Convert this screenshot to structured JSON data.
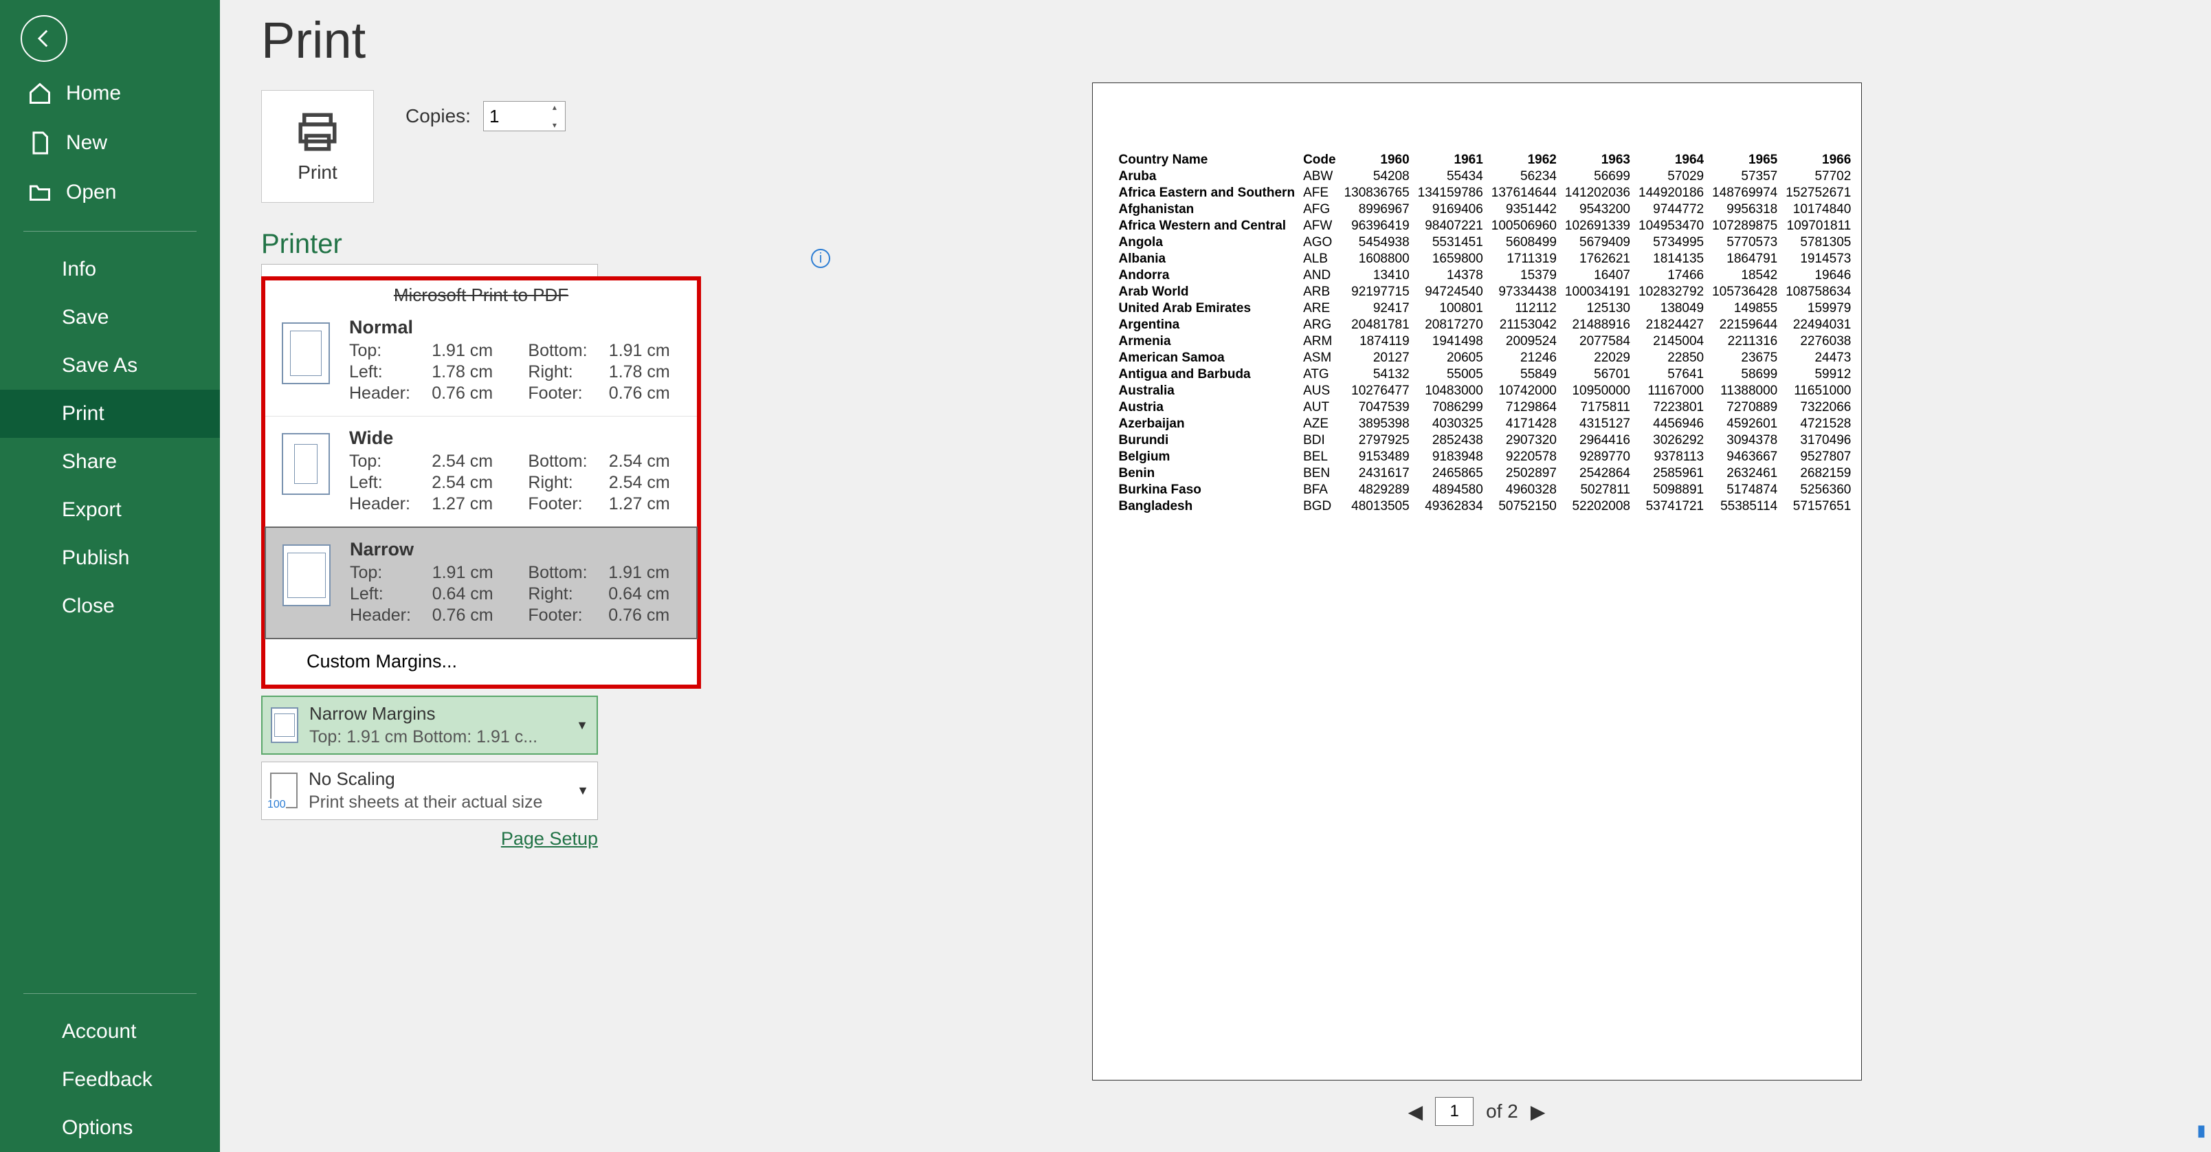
{
  "sidebar": {
    "home": "Home",
    "new": "New",
    "open": "Open",
    "info": "Info",
    "save": "Save",
    "saveas": "Save As",
    "print": "Print",
    "share": "Share",
    "export": "Export",
    "publish": "Publish",
    "close": "Close",
    "account": "Account",
    "feedback": "Feedback",
    "options": "Options"
  },
  "page": {
    "title": "Print",
    "print_label": "Print",
    "copies_label": "Copies:",
    "copies_value": "1",
    "printer_heading": "Printer",
    "hidden_printer": "Microsoft Print to PDF"
  },
  "margins": {
    "custom": "Custom Margins...",
    "options": [
      {
        "name": "Normal",
        "top_l": "Top:",
        "top_v": "1.91 cm",
        "bot_l": "Bottom:",
        "bot_v": "1.91 cm",
        "left_l": "Left:",
        "left_v": "1.78 cm",
        "right_l": "Right:",
        "right_v": "1.78 cm",
        "hdr_l": "Header:",
        "hdr_v": "0.76 cm",
        "ftr_l": "Footer:",
        "ftr_v": "0.76 cm"
      },
      {
        "name": "Wide",
        "top_l": "Top:",
        "top_v": "2.54 cm",
        "bot_l": "Bottom:",
        "bot_v": "2.54 cm",
        "left_l": "Left:",
        "left_v": "2.54 cm",
        "right_l": "Right:",
        "right_v": "2.54 cm",
        "hdr_l": "Header:",
        "hdr_v": "1.27 cm",
        "ftr_l": "Footer:",
        "ftr_v": "1.27 cm"
      },
      {
        "name": "Narrow",
        "top_l": "Top:",
        "top_v": "1.91 cm",
        "bot_l": "Bottom:",
        "bot_v": "1.91 cm",
        "left_l": "Left:",
        "left_v": "0.64 cm",
        "right_l": "Right:",
        "right_v": "0.64 cm",
        "hdr_l": "Header:",
        "hdr_v": "0.76 cm",
        "ftr_l": "Footer:",
        "ftr_v": "0.76 cm"
      }
    ]
  },
  "settings_rows": {
    "margins_title": "Narrow Margins",
    "margins_sub": "Top: 1.91 cm Bottom: 1.91 c...",
    "scaling_title": "No Scaling",
    "scaling_sub": "Print sheets at their actual size"
  },
  "page_setup": "Page Setup",
  "pager": {
    "current": "1",
    "of": "of 2"
  },
  "preview": {
    "headers": [
      "Country Name",
      "Code",
      "1960",
      "1961",
      "1962",
      "1963",
      "1964",
      "1965",
      "1966"
    ],
    "rows": [
      [
        "Aruba",
        "ABW",
        "54208",
        "55434",
        "56234",
        "56699",
        "57029",
        "57357",
        "57702"
      ],
      [
        "Africa Eastern and Southern",
        "AFE",
        "130836765",
        "134159786",
        "137614644",
        "141202036",
        "144920186",
        "148769974",
        "152752671"
      ],
      [
        "Afghanistan",
        "AFG",
        "8996967",
        "9169406",
        "9351442",
        "9543200",
        "9744772",
        "9956318",
        "10174840"
      ],
      [
        "Africa Western and Central",
        "AFW",
        "96396419",
        "98407221",
        "100506960",
        "102691339",
        "104953470",
        "107289875",
        "109701811"
      ],
      [
        "Angola",
        "AGO",
        "5454938",
        "5531451",
        "5608499",
        "5679409",
        "5734995",
        "5770573",
        "5781305"
      ],
      [
        "Albania",
        "ALB",
        "1608800",
        "1659800",
        "1711319",
        "1762621",
        "1814135",
        "1864791",
        "1914573"
      ],
      [
        "Andorra",
        "AND",
        "13410",
        "14378",
        "15379",
        "16407",
        "17466",
        "18542",
        "19646"
      ],
      [
        "Arab World",
        "ARB",
        "92197715",
        "94724540",
        "97334438",
        "100034191",
        "102832792",
        "105736428",
        "108758634"
      ],
      [
        "United Arab Emirates",
        "ARE",
        "92417",
        "100801",
        "112112",
        "125130",
        "138049",
        "149855",
        "159979"
      ],
      [
        "Argentina",
        "ARG",
        "20481781",
        "20817270",
        "21153042",
        "21488916",
        "21824427",
        "22159644",
        "22494031"
      ],
      [
        "Armenia",
        "ARM",
        "1874119",
        "1941498",
        "2009524",
        "2077584",
        "2145004",
        "2211316",
        "2276038"
      ],
      [
        "American Samoa",
        "ASM",
        "20127",
        "20605",
        "21246",
        "22029",
        "22850",
        "23675",
        "24473"
      ],
      [
        "Antigua and Barbuda",
        "ATG",
        "54132",
        "55005",
        "55849",
        "56701",
        "57641",
        "58699",
        "59912"
      ],
      [
        "Australia",
        "AUS",
        "10276477",
        "10483000",
        "10742000",
        "10950000",
        "11167000",
        "11388000",
        "11651000"
      ],
      [
        "Austria",
        "AUT",
        "7047539",
        "7086299",
        "7129864",
        "7175811",
        "7223801",
        "7270889",
        "7322066"
      ],
      [
        "Azerbaijan",
        "AZE",
        "3895398",
        "4030325",
        "4171428",
        "4315127",
        "4456946",
        "4592601",
        "4721528"
      ],
      [
        "Burundi",
        "BDI",
        "2797925",
        "2852438",
        "2907320",
        "2964416",
        "3026292",
        "3094378",
        "3170496"
      ],
      [
        "Belgium",
        "BEL",
        "9153489",
        "9183948",
        "9220578",
        "9289770",
        "9378113",
        "9463667",
        "9527807"
      ],
      [
        "Benin",
        "BEN",
        "2431617",
        "2465865",
        "2502897",
        "2542864",
        "2585961",
        "2632461",
        "2682159"
      ],
      [
        "Burkina Faso",
        "BFA",
        "4829289",
        "4894580",
        "4960328",
        "5027811",
        "5098891",
        "5174874",
        "5256360"
      ],
      [
        "Bangladesh",
        "BGD",
        "48013505",
        "49362834",
        "50752150",
        "52202008",
        "53741721",
        "55385114",
        "57157651"
      ]
    ]
  }
}
